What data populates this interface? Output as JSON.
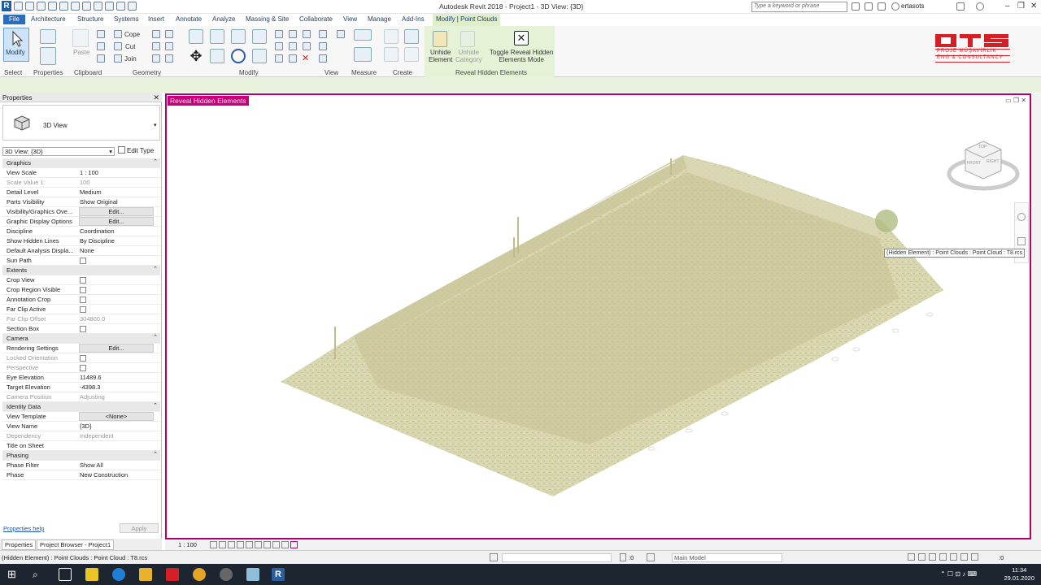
{
  "title_bar": {
    "app_title": "Autodesk Revit 2018 -    Project1 - 3D View: {3D}",
    "search_placeholder": "Type a keyword or phrase",
    "user": "ertasots"
  },
  "ribbon_tabs": [
    "File",
    "Architecture",
    "Structure",
    "Systems",
    "Insert",
    "Annotate",
    "Analyze",
    "Massing & Site",
    "Collaborate",
    "View",
    "Manage",
    "Add-Ins",
    "Modify | Point Clouds"
  ],
  "ribbon": {
    "modify": "Modify",
    "paste": "Paste",
    "cope": "Cope",
    "cut": "Cut",
    "join": "Join",
    "unhide_element": "Unhide\nElement",
    "unhide_category": "Unhide\nCategory",
    "toggle_reveal": "Toggle Reveal Hidden\nElements Mode",
    "groups": [
      "Select",
      "Properties",
      "Clipboard",
      "Geometry",
      "Modify",
      "View",
      "Measure",
      "Create",
      "Reveal Hidden Elements"
    ]
  },
  "logo": {
    "name": "OTS",
    "line1": "PROJE MÜŞAVİRLİK",
    "line2": "ENG & CONSULTANCY"
  },
  "properties": {
    "title": "Properties",
    "type_name": "3D View",
    "view_selector": "3D View: {3D}",
    "edit_type": "Edit Type",
    "rows": [
      {
        "k": "Graphics",
        "sec": true
      },
      {
        "k": "View Scale",
        "v": "1 : 100"
      },
      {
        "k": "Scale Value    1:",
        "v": "100",
        "dis": true
      },
      {
        "k": "Detail Level",
        "v": "Medium"
      },
      {
        "k": "Parts Visibility",
        "v": "Show Original"
      },
      {
        "k": "Visibility/Graphics Ove...",
        "btn": "Edit..."
      },
      {
        "k": "Graphic Display Options",
        "btn": "Edit..."
      },
      {
        "k": "Discipline",
        "v": "Coordination"
      },
      {
        "k": "Show Hidden Lines",
        "v": "By Discipline"
      },
      {
        "k": "Default Analysis Displa...",
        "v": "None"
      },
      {
        "k": "Sun Path",
        "cb": true
      },
      {
        "k": "Extents",
        "sec": true
      },
      {
        "k": "Crop View",
        "cb": true
      },
      {
        "k": "Crop Region Visible",
        "cb": true
      },
      {
        "k": "Annotation Crop",
        "cb": true
      },
      {
        "k": "Far Clip Active",
        "cb": true
      },
      {
        "k": "Far Clip Offset",
        "v": "304800.0",
        "dis": true
      },
      {
        "k": "Section Box",
        "cb": true
      },
      {
        "k": "Camera",
        "sec": true
      },
      {
        "k": "Rendering Settings",
        "btn": "Edit..."
      },
      {
        "k": "Locked Orientation",
        "cb": true,
        "dis": true
      },
      {
        "k": "Perspective",
        "cb": true,
        "dis": true
      },
      {
        "k": "Eye Elevation",
        "v": "11489.6"
      },
      {
        "k": "Target Elevation",
        "v": "-4398.3"
      },
      {
        "k": "Camera Position",
        "v": "Adjusting",
        "dis": true
      },
      {
        "k": "Identity Data",
        "sec": true
      },
      {
        "k": "View Template",
        "btn": "<None>"
      },
      {
        "k": "View Name",
        "v": "{3D}"
      },
      {
        "k": "Dependency",
        "v": "Independent",
        "dis": true
      },
      {
        "k": "Title on Sheet",
        "v": ""
      },
      {
        "k": "Phasing",
        "sec": true
      },
      {
        "k": "Phase Filter",
        "v": "Show All"
      },
      {
        "k": "Phase",
        "v": "New Construction"
      }
    ],
    "help": "Properties help",
    "apply": "Apply",
    "tab_properties": "Properties",
    "tab_browser": "Project Browser - Project1"
  },
  "view": {
    "mode_label": "Reveal Hidden Elements",
    "tooltip": "(Hidden Element) : Point Clouds : Point Cloud : T8.rcs",
    "viewcube": {
      "top": "TOP",
      "front": "FRONT",
      "right": "RIGHT"
    }
  },
  "view_bar": {
    "scale": "1 : 100"
  },
  "status_bar": {
    "text": "(Hidden Element) : Point Clouds : Point Cloud : T8.rcs",
    "filter_count": ":0",
    "model": "Main Model",
    "right_count": ":0"
  },
  "taskbar": {
    "time": "11:34",
    "date": "29.01.2020"
  },
  "colors": {
    "reveal_border": "#b4006c",
    "point_cloud": "#cfcf9f",
    "file_tab": "#2a6ebb",
    "logo_red": "#d41f26"
  }
}
